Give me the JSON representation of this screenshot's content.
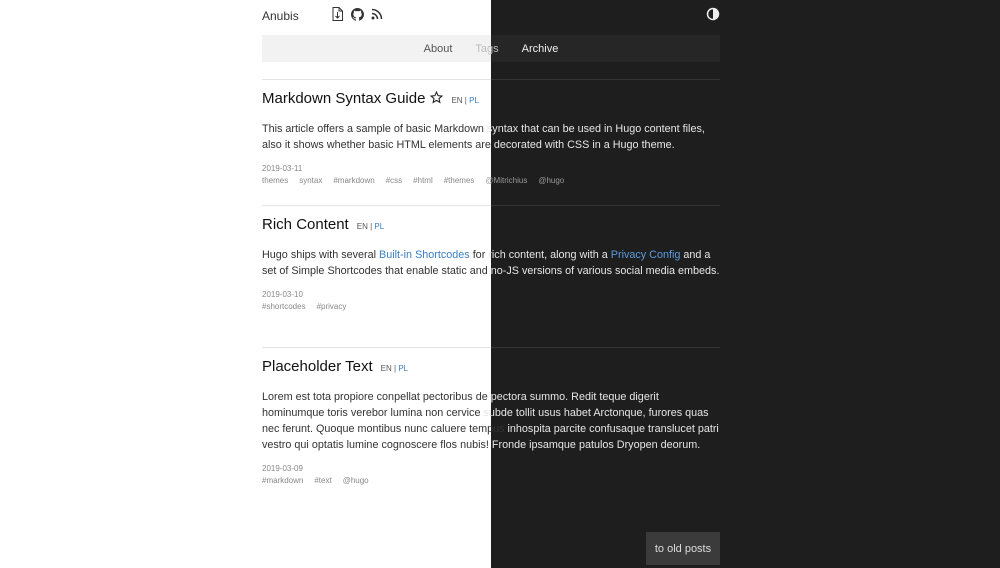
{
  "site": {
    "title": "Anubis",
    "icons": [
      "rss-file-icon",
      "github-icon",
      "rss-icon"
    ],
    "theme_toggle_icon": "contrast-icon"
  },
  "nav": {
    "items": [
      "About",
      "Tags",
      "Archive"
    ]
  },
  "posts": [
    {
      "title": "Markdown Syntax Guide",
      "starred": true,
      "lang_en": "EN",
      "lang_sep": "|",
      "lang_pl": "PL",
      "excerpt": "This article offers a sample of basic Markdown syntax that can be used in Hugo content files, also it shows whether basic HTML elements are decorated with CSS in a Hugo theme.",
      "date": "2019-03-11",
      "tags": [
        "themes",
        "syntax",
        "#markdown",
        "#css",
        "#html",
        "#themes",
        "@Mitrichius",
        "@hugo"
      ]
    },
    {
      "title": "Rich Content",
      "starred": false,
      "lang_en": "EN",
      "lang_sep": "|",
      "lang_pl": "PL",
      "excerpt_parts": {
        "a": "Hugo ships with several ",
        "link1": "Built-in Shortcodes",
        "b": " for rich content, along with a ",
        "link2": "Privacy Config",
        "c": " and a set of Simple Shortcodes that enable static and no-JS versions of various social media embeds."
      },
      "date": "2019-03-10",
      "tags": [
        "#shortcodes",
        "#privacy"
      ]
    },
    {
      "title": "Placeholder Text",
      "starred": false,
      "lang_en": "EN",
      "lang_sep": "|",
      "lang_pl": "PL",
      "excerpt": "Lorem est tota propiore conpellat pectoribus de pectora summo. Redit teque digerit hominumque toris verebor lumina non cervice subde tollit usus habet Arctonque, furores quas nec ferunt. Quoque montibus nunc caluere tempus inhospita parcite confusaque translucet patri vestro qui optatis lumine cognoscere flos nubis! Fronde ipsamque patulos Dryopen deorum.",
      "date": "2019-03-09",
      "tags": [
        "#markdown",
        "#text",
        "@hugo"
      ]
    }
  ],
  "pagination": {
    "older_label": "to old posts"
  },
  "colors": {
    "light_bg": "#ffffff",
    "dark_bg": "#1e1e1e",
    "link": "#3b7fc4"
  }
}
